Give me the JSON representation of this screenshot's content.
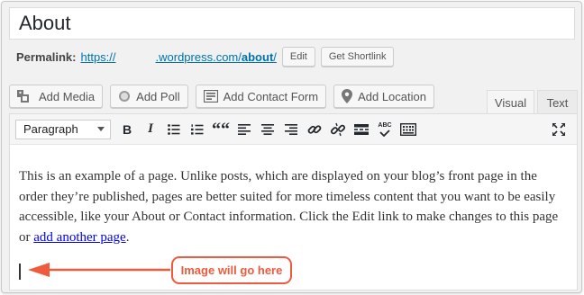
{
  "title": {
    "value": "About"
  },
  "permalink": {
    "label": "Permalink:",
    "url_prefix": "https://",
    "url_domain": ".wordpress.com/",
    "url_slug": "about",
    "url_suffix": "/",
    "edit_button": "Edit",
    "shortlink_button": "Get Shortlink"
  },
  "media_buttons": {
    "add_media": "Add Media",
    "add_poll": "Add Poll",
    "add_contact_form": "Add Contact Form",
    "add_location": "Add Location"
  },
  "tabs": {
    "visual": "Visual",
    "text": "Text"
  },
  "toolbar": {
    "format_selected": "Paragraph",
    "buttons": [
      "bold-icon",
      "italic-icon",
      "bullet-list-icon",
      "numbered-list-icon",
      "blockquote-icon",
      "align-left-icon",
      "align-center-icon",
      "align-right-icon",
      "link-icon",
      "unlink-icon",
      "read-more-icon",
      "spellcheck-icon",
      "toolbar-toggle-icon",
      "fullscreen-icon"
    ],
    "bold_glyph": "B",
    "italic_glyph": "I",
    "quote_glyph": "““",
    "spell_glyph": "ABC"
  },
  "content": {
    "paragraph": "This is an example of a page. Unlike posts, which are displayed on your blog’s front page in the order they’re published, pages are better suited for more timeless content that you want to be easily accessible, like your About or Contact information. Click the Edit link to make changes to this page or ",
    "link_text": "add another page",
    "paragraph_end": "."
  },
  "annotation": {
    "callout_text": "Image will go here",
    "color": "#f05a3c"
  }
}
